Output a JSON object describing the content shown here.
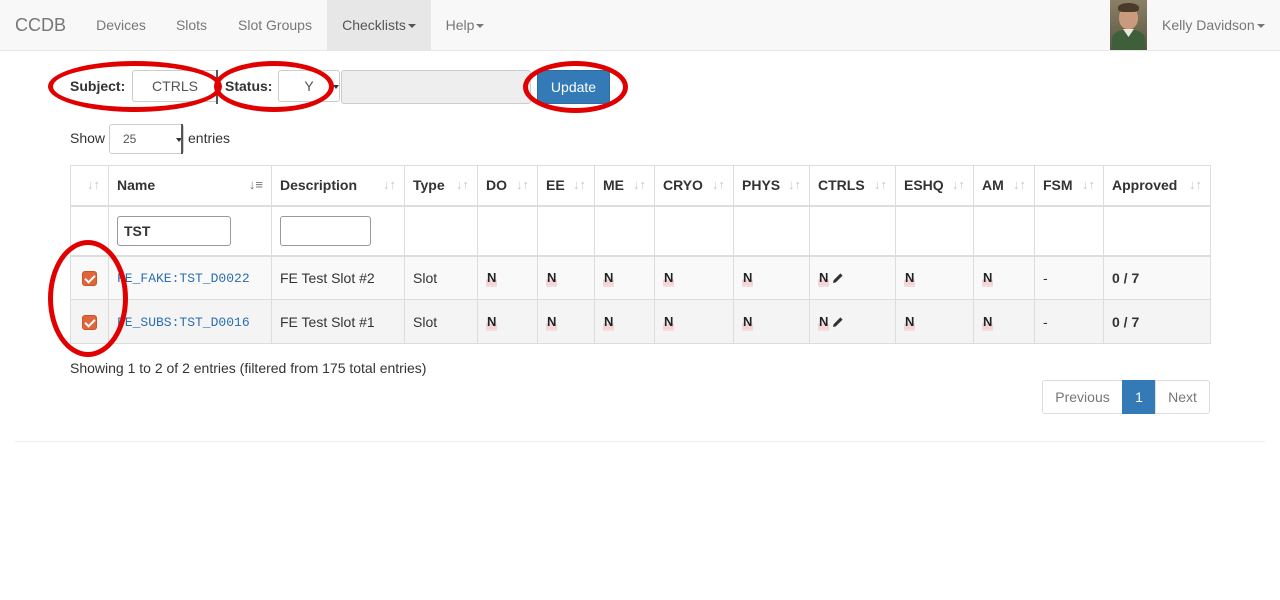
{
  "navbar": {
    "brand": "CCDB",
    "items": [
      {
        "label": "Devices"
      },
      {
        "label": "Slots"
      },
      {
        "label": "Slot Groups"
      },
      {
        "label": "Checklists"
      },
      {
        "label": "Help"
      }
    ],
    "user": "Kelly Davidson"
  },
  "filters": {
    "subject_label": "Subject:",
    "subject_value": "CTRLS",
    "status_label": "Status:",
    "status_value": "Y",
    "comment_value": "",
    "update_label": "Update"
  },
  "length": {
    "show_label": "Show",
    "value": "25",
    "entries_label": "entries"
  },
  "table": {
    "columns": [
      "",
      "Name",
      "Description",
      "Type",
      "DO",
      "EE",
      "ME",
      "CRYO",
      "PHYS",
      "CTRLS",
      "ESHQ",
      "AM",
      "FSM",
      "Approved"
    ],
    "name_filter": "TST",
    "description_filter": "",
    "rows": [
      {
        "name": "FE_FAKE:TST_D0022",
        "description": "FE Test Slot #2",
        "type": "Slot",
        "do": "N",
        "ee": "N",
        "me": "N",
        "cryo": "N",
        "phys": "N",
        "ctrls": "N",
        "eshq": "N",
        "am": "N",
        "fsm": "-",
        "approved": "0 / 7"
      },
      {
        "name": "FE_SUBS:TST_D0016",
        "description": "FE Test Slot #1",
        "type": "Slot",
        "do": "N",
        "ee": "N",
        "me": "N",
        "cryo": "N",
        "phys": "N",
        "ctrls": "N",
        "eshq": "N",
        "am": "N",
        "fsm": "-",
        "approved": "0 / 7"
      }
    ]
  },
  "info": "Showing 1 to 2 of 2 entries (filtered from 175 total entries)",
  "pagination": {
    "previous": "Previous",
    "current": "1",
    "next": "Next"
  },
  "icons": {
    "sort": "sort-icon",
    "pencil": "pencil-icon",
    "checkbox": "checked-checkbox-icon"
  },
  "colors": {
    "accent": "#337ab7",
    "checkbox": "#e1653a",
    "annotation": "#e00000"
  }
}
